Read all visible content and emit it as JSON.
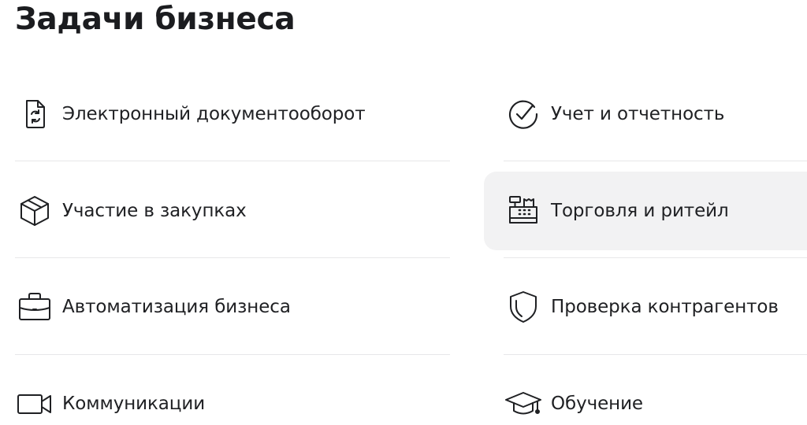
{
  "title": "Задачи бизнеса",
  "tasks": [
    {
      "label": "Электронный документооборот",
      "icon": "document-sync-icon"
    },
    {
      "label": "Учет и отчетность",
      "icon": "check-circle-icon"
    },
    {
      "label": "Участие в закупках",
      "icon": "box-icon"
    },
    {
      "label": "Торговля и ритейл",
      "icon": "cash-register-icon",
      "active": true
    },
    {
      "label": "Автоматизация бизнеса",
      "icon": "briefcase-icon"
    },
    {
      "label": "Проверка контрагентов",
      "icon": "shield-icon"
    },
    {
      "label": "Коммуникации",
      "icon": "video-camera-icon"
    },
    {
      "label": "Обучение",
      "icon": "graduation-cap-icon"
    }
  ],
  "colors": {
    "text": "#1f2023",
    "divider": "#e7e7e9",
    "active_background": "#f2f2f3"
  }
}
